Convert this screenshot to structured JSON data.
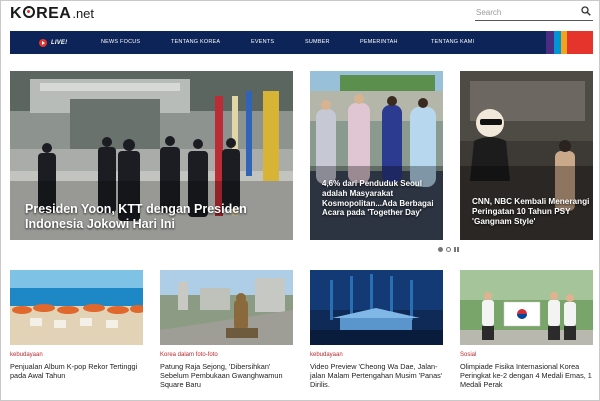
{
  "header": {
    "logo_korea": "K",
    "logo_rea": "REA",
    "logo_net": ".net",
    "search_placeholder": "Search"
  },
  "nav": {
    "live": "LIVE!",
    "items": [
      "NEWS FOCUS",
      "TENTANG KOREA",
      "EVENTS",
      "SUMBER",
      "PEMERINTAH",
      "TENTANG KAMI"
    ],
    "stripe_colors": [
      "#4a2d83",
      "#0096d6",
      "#f1a51d",
      "#e4342b"
    ]
  },
  "hero": [
    {
      "title": "Presiden Yoon, KTT dengan Presiden Indonesia Jokowi Hari Ini"
    },
    {
      "title": "4,6% dari Penduduk Seoul adalah Masyarakat Kosmopolitan...Ada Berbagai Acara pada 'Together Day'"
    },
    {
      "title": "CNN, NBC Kembali Menerangi Peringatan 10 Tahun PSY 'Gangnam Style'"
    }
  ],
  "carousel": {
    "active_index": 0,
    "count": 2
  },
  "cards": [
    {
      "category": "kebudayaan",
      "title": "Penjualan Album K-pop Rekor Tertinggi pada Awal Tahun"
    },
    {
      "category": "Korea dalam foto-foto",
      "title": "Patung Raja Sejong, 'Dibersihkan' Sebelum Pembukaan Gwanghwamun Square Baru"
    },
    {
      "category": "kebudayaan",
      "title": "Video Preview 'Cheong Wa Dae, Jalan-jalan Malam Pertengahan Musim 'Panas' Dirilis."
    },
    {
      "category": "Sosial",
      "title": "Olimpiade Fisika Internasional Korea Peringkat ke-2 dengan 4 Medali Emas, 1 Medali Perak"
    }
  ],
  "colors": {
    "navbar": "#0c2457",
    "category": "#b8292f",
    "accent_red": "#e4342b"
  }
}
